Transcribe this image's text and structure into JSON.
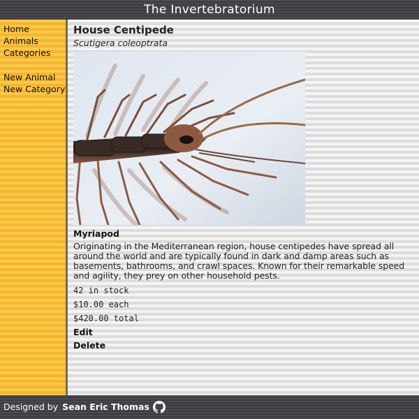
{
  "site": {
    "title": "The Invertebratorium"
  },
  "sidebar": {
    "items": [
      {
        "label": "Home"
      },
      {
        "label": "Animals"
      },
      {
        "label": "Categories"
      },
      {
        "label": "New Animal"
      },
      {
        "label": "New Category"
      }
    ]
  },
  "animal": {
    "name": "House Centipede",
    "scientific_name": "Scutigera coleoptrata",
    "image_icon": "centipede-photo",
    "category": "Myriapod",
    "description": "Originating in the Mediterranean region, house centipedes have spread all around the world and are typically found in dark and damp areas such as basements, bathrooms, and crawl spaces. Known for their remarkable speed and agility, they prey on other household pests.",
    "stock": "42 in stock",
    "price": "$10.00 each",
    "total": "$420.00 total",
    "edit_label": "Edit",
    "delete_label": "Delete"
  },
  "footer": {
    "designed_by": "Designed by",
    "author": "Sean Eric Thomas",
    "icon": "github-icon"
  },
  "colors": {
    "header_bg": "#444448",
    "sidebar_bg": "#fcc94a",
    "main_bg": "#ebebeb",
    "text": "#222222"
  }
}
